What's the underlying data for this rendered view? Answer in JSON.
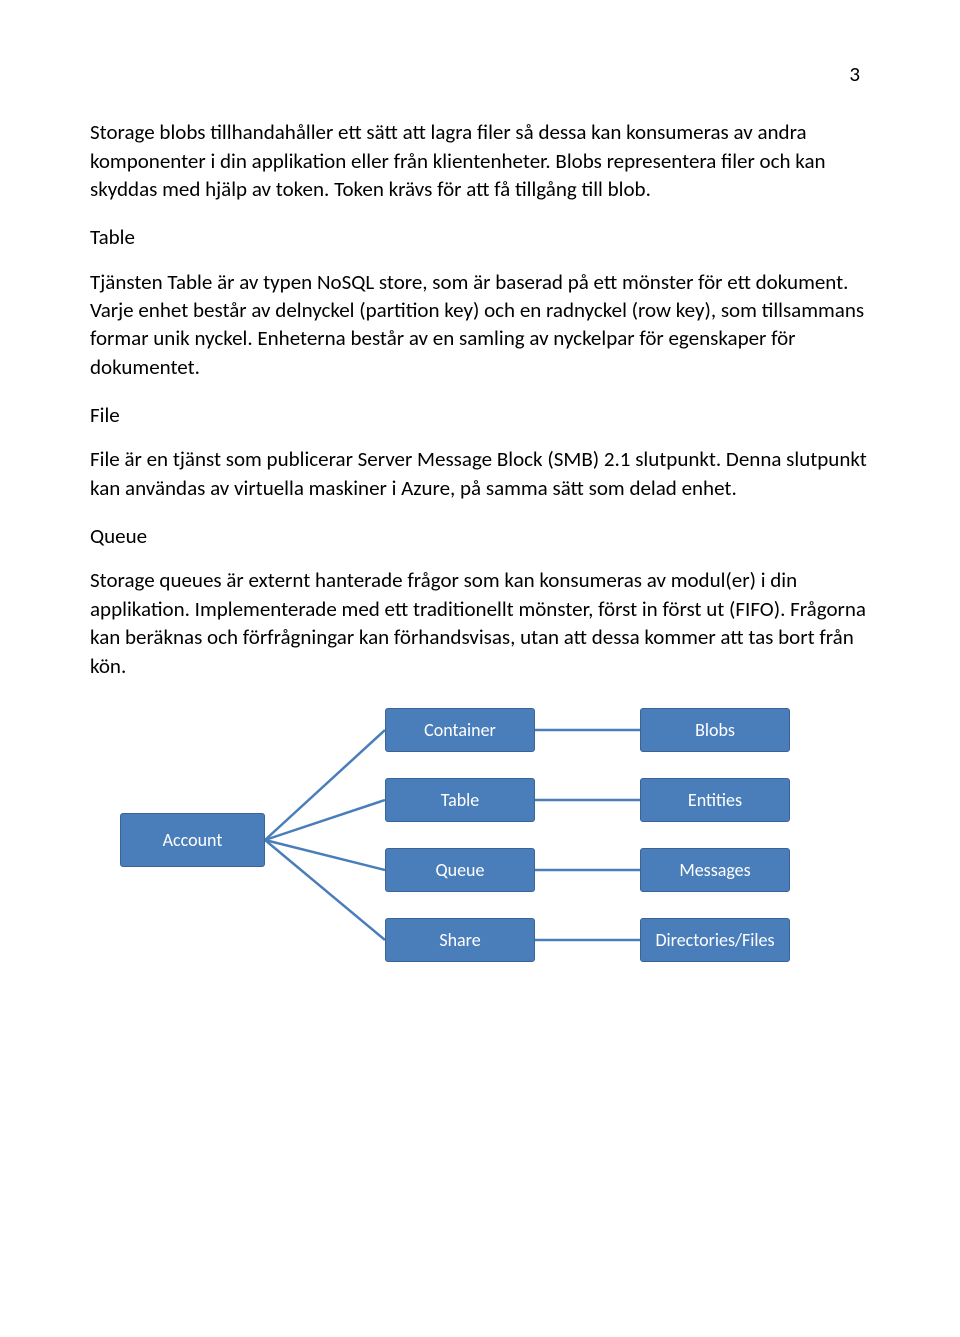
{
  "page_number": "3",
  "paragraphs": {
    "blobs_intro": "Storage blobs tillhandahåller ett sätt att lagra filer så dessa kan konsumeras av andra komponenter i din applikation eller från klientenheter. Blobs representera filer och kan skyddas med hjälp av token. Token krävs för att få tillgång till blob.",
    "table_heading": "Table",
    "table_body": "Tjänsten Table är av typen NoSQL store, som är baserad på ett mönster för ett dokument. Varje enhet består av delnyckel (partition key) och en radnyckel (row key), som tillsammans formar unik nyckel. Enheterna består av en samling av nyckelpar för egenskaper för dokumentet.",
    "file_heading": "File",
    "file_body": "File är en tjänst som publicerar Server Message Block (SMB) 2.1 slutpunkt. Denna slutpunkt kan användas av virtuella maskiner i Azure, på samma sätt som delad enhet.",
    "queue_heading": "Queue",
    "queue_body": "Storage queues är externt hanterade frågor som kan konsumeras av modul(er) i din applikation. Implementerade med ett traditionellt mönster, först in först ut (FIFO). Frågorna kan beräknas och förfrågningar kan förhandsvisas, utan att dessa kommer att tas bort från kön."
  },
  "diagram": {
    "account": "Account",
    "container": "Container",
    "blobs": "Blobs",
    "table": "Table",
    "entities": "Entities",
    "queue": "Queue",
    "messages": "Messages",
    "share": "Share",
    "dirfiles": "Directories/Files"
  }
}
